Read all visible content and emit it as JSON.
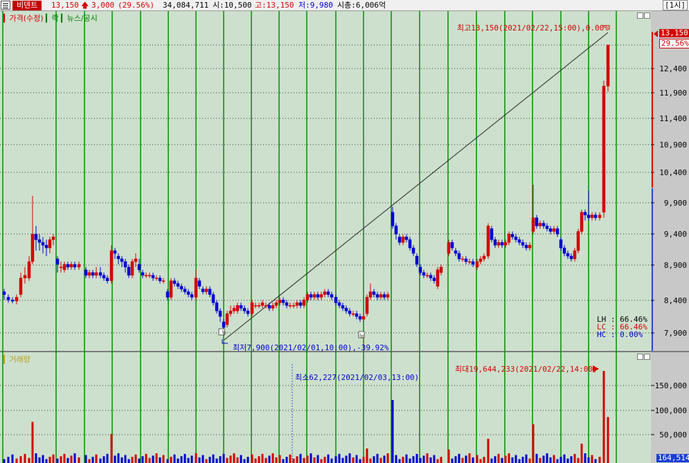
{
  "header": {
    "stock_name": "비덴트",
    "price": "13,150",
    "change": "3,000",
    "change_pct": "(29.56%)",
    "volume": "34,084,711",
    "open": "시:10,500",
    "high": "고:13,150",
    "low": "저:9,980",
    "market_cap": "시총:6,006억",
    "period": "[1시]"
  },
  "price_pane": {
    "labels": [
      "가격(수정)",
      "락",
      "뉴스/공시"
    ],
    "max_annotation": "최고13,150(2021/02/22,15:00),0.00%",
    "min_annotation": "최저7,900(2021/02/01,10:00),-39.92%",
    "axis_ticks": [
      "12,400",
      "11,900",
      "11,400",
      "10,900",
      "10,400",
      "9,900",
      "9,400",
      "8,900",
      "8,400",
      "7,900"
    ],
    "current_price": "13,150",
    "current_pct": "29.56%",
    "lh": "LH :  66.46%",
    "lc": "LC :  66.46%",
    "hc": "HC :   0.00%",
    "news_icon": "뉴"
  },
  "volume_pane": {
    "label": "거래량",
    "min_annotation": "최소62,227(2021/02/03,13:00)",
    "max_annotation": "최대19,644,233(2021/02/22,14:00)",
    "axis_ticks": [
      "150,000",
      "100,000",
      "50,000"
    ],
    "current_volume": "164,514"
  },
  "colors": {
    "up": "#d40000",
    "down": "#0000d0",
    "background": "#cde0cd",
    "axis_bg": "#c8c8c8",
    "grid_line": "#008000"
  }
}
